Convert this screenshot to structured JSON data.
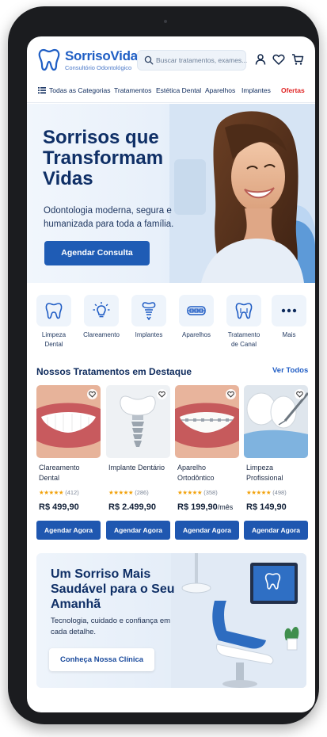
{
  "header": {
    "brand": "SorrisoVida",
    "brand_sub": "Consultório Odontológico",
    "search_placeholder": "Buscar tratamentos, exames..."
  },
  "nav": {
    "items": [
      "Todas as Categorias",
      "Tratamentos",
      "Estética Dental",
      "Aparelhos",
      "Implantes",
      "Ofertas"
    ]
  },
  "hero": {
    "title": "Sorrisos que Transformam Vidas",
    "subtitle": "Odontologia moderna, segura e humanizada para toda a família.",
    "button": "Agendar Consulta"
  },
  "categories": [
    {
      "label": "Limpeza Dental",
      "icon": "tooth-icon"
    },
    {
      "label": "Clareamento",
      "icon": "lightbulb-icon"
    },
    {
      "label": "Implantes",
      "icon": "implant-icon"
    },
    {
      "label": "Aparelhos",
      "icon": "braces-icon"
    },
    {
      "label": "Tratamento de Canal",
      "icon": "tooth-icon"
    },
    {
      "label": "Mais",
      "icon": "more-icon"
    }
  ],
  "featured": {
    "title": "Nossos Tratamentos em Destaque",
    "link": "Ver Todos"
  },
  "products": [
    {
      "name": "Clareamento Dental",
      "stars": "★★★★★",
      "reviews": "(412)",
      "price": "R$ 499,90",
      "suffix": "",
      "button": "Agendar Agora"
    },
    {
      "name": "Implante Dentário",
      "stars": "★★★★★",
      "reviews": "(286)",
      "price": "R$ 2.499,90",
      "suffix": "",
      "button": "Agendar Agora"
    },
    {
      "name": "Aparelho Ortodôntico",
      "stars": "★★★★★",
      "reviews": "(358)",
      "price": "R$ 199,90",
      "suffix": "/mês",
      "button": "Agendar Agora"
    },
    {
      "name": "Limpeza Profissional",
      "stars": "★★★★★",
      "reviews": "(498)",
      "price": "R$ 149,90",
      "suffix": "",
      "button": "Agendar Agora"
    }
  ],
  "banner": {
    "title": "Um Sorriso Mais Saudável para o Seu Amanhã",
    "subtitle": "Tecnologia, cuidado e confiança em cada detalhe.",
    "button": "Conheça Nossa Clínica"
  },
  "colors": {
    "primary": "#1f5cb5",
    "brand": "#1f5ec4",
    "offer": "#e02424",
    "star": "#f2a20c"
  }
}
